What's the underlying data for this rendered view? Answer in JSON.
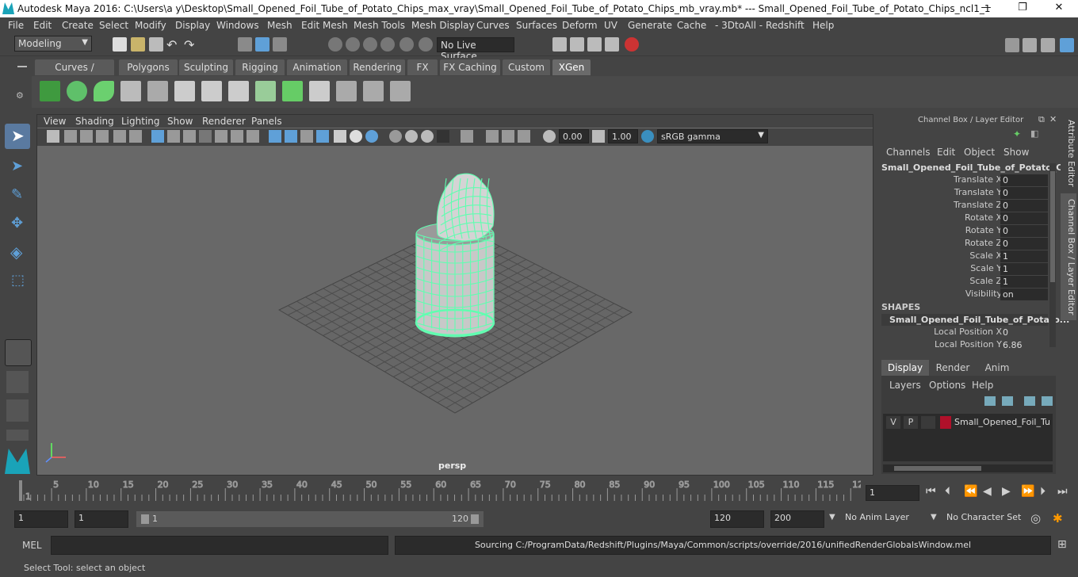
{
  "window": {
    "title": "Autodesk Maya 2016: C:\\Users\\a y\\Desktop\\Small_Opened_Foil_Tube_of_Potato_Chips_max_vray\\Small_Opened_Foil_Tube_of_Potato_Chips_mb_vray.mb*   ---   Small_Opened_Foil_Tube_of_Potato_Chips_ncl1_1",
    "minimize": "—",
    "maximize": "❐",
    "close": "✕"
  },
  "menubar": [
    "File",
    "Edit",
    "Create",
    "Select",
    "Modify",
    "Display",
    "Windows",
    "Mesh",
    "Edit Mesh",
    "Mesh Tools",
    "Mesh Display",
    "Curves",
    "Surfaces",
    "Deform",
    "UV",
    "Generate",
    "Cache",
    "- 3DtoAll -",
    "Redshift",
    "Help"
  ],
  "statusline": {
    "mode": "Modeling",
    "live_surface": "No Live Surface"
  },
  "shelf_tabs": [
    "Curves / Surfaces",
    "Polygons",
    "Sculpting",
    "Rigging",
    "Animation",
    "Rendering",
    "FX",
    "FX Caching",
    "Custom",
    "XGen"
  ],
  "shelf_active": "XGen",
  "viewport": {
    "menus": [
      "View",
      "Shading",
      "Lighting",
      "Show",
      "Renderer",
      "Panels"
    ],
    "exposure": "0.00",
    "gamma": "1.00",
    "colorspace": "sRGB gamma",
    "camera_label": "persp"
  },
  "channel_box": {
    "header": "Channel Box / Layer Editor",
    "menus": [
      "Channels",
      "Edit",
      "Object",
      "Show"
    ],
    "object_name": "Small_Opened_Foil_Tube_of_Potato_C...",
    "channels": [
      {
        "label": "Translate X",
        "value": "0"
      },
      {
        "label": "Translate Y",
        "value": "0"
      },
      {
        "label": "Translate Z",
        "value": "0"
      },
      {
        "label": "Rotate X",
        "value": "0"
      },
      {
        "label": "Rotate Y",
        "value": "0"
      },
      {
        "label": "Rotate Z",
        "value": "0"
      },
      {
        "label": "Scale X",
        "value": "1"
      },
      {
        "label": "Scale Y",
        "value": "1"
      },
      {
        "label": "Scale Z",
        "value": "1"
      },
      {
        "label": "Visibility",
        "value": "on"
      }
    ],
    "shapes_header": "SHAPES",
    "shape_name": "Small_Opened_Foil_Tube_of_Potato...",
    "shape_channels": [
      {
        "label": "Local Position X",
        "value": "0"
      },
      {
        "label": "Local Position Y",
        "value": "6.86"
      }
    ],
    "side_tabs": [
      "Attribute Editor",
      "Channel Box / Layer Editor"
    ]
  },
  "layer_editor": {
    "tabs": [
      "Display",
      "Render",
      "Anim"
    ],
    "menus": [
      "Layers",
      "Options",
      "Help"
    ],
    "layer": {
      "v": "V",
      "p": "P",
      "name": "Small_Opened_Foil_Tube",
      "color": "#b0102a"
    }
  },
  "timeline": {
    "ticks": [
      "1",
      "5",
      "10",
      "15",
      "20",
      "25",
      "30",
      "35",
      "40",
      "45",
      "50",
      "55",
      "60",
      "65",
      "70",
      "75",
      "80",
      "85",
      "90",
      "95",
      "100",
      "105",
      "110",
      "115",
      "12"
    ],
    "current_frame": "1"
  },
  "range": {
    "start": "1",
    "playback_start": "1",
    "slider_start": "1",
    "slider_end": "120",
    "playback_end": "120",
    "end": "200",
    "anim_layer": "No Anim Layer",
    "character_set": "No Character Set"
  },
  "command": {
    "label": "MEL",
    "output": "Sourcing C:/ProgramData/Redshift/Plugins/Maya/Common/scripts/override/2016/unifiedRenderGlobalsWindow.mel"
  },
  "help_line": "Select Tool: select an object",
  "colors": {
    "wire": "#5fffb0",
    "accent": "#5fa0d8"
  }
}
